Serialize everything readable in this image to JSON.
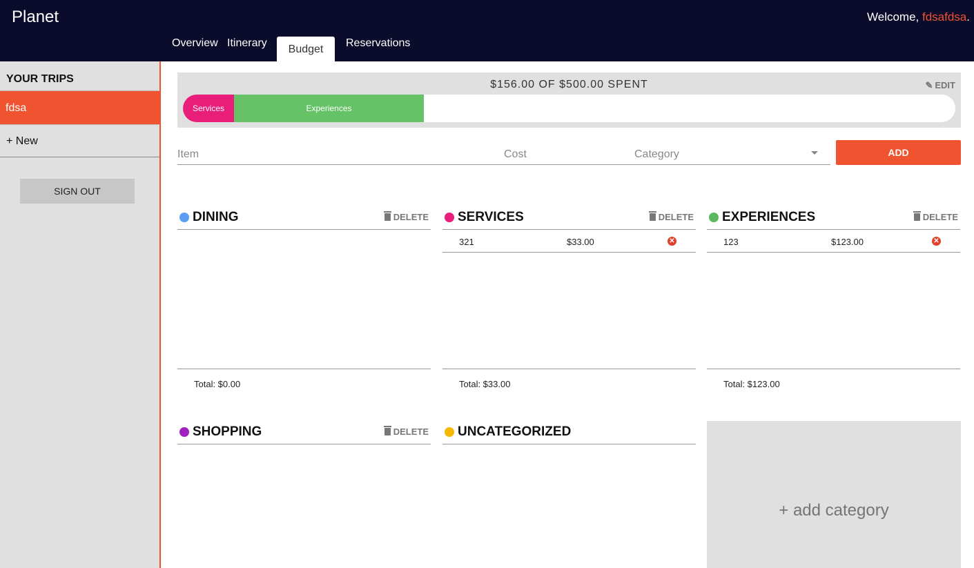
{
  "app": {
    "brand": "Planet"
  },
  "header": {
    "welcome_prefix": "Welcome, ",
    "username": "fdsafdsa",
    "welcome_suffix": "."
  },
  "tabs": [
    {
      "label": "Overview"
    },
    {
      "label": "Itinerary"
    },
    {
      "label": "Budget",
      "active": true
    },
    {
      "label": "Reservations"
    }
  ],
  "sidebar": {
    "title": "YOUR TRIPS",
    "trips": [
      {
        "label": "fdsa",
        "selected": true
      }
    ],
    "new_label": "+ New",
    "signout_label": "SIGN OUT"
  },
  "budget": {
    "summary": "$156.00 OF $500.00 SPENT",
    "edit_label": "EDIT",
    "segments": [
      {
        "label": "Services",
        "amount": 33,
        "color": "#e91e7a"
      },
      {
        "label": "Experiences",
        "amount": 123,
        "color": "#66c266"
      }
    ],
    "budget_total": 500
  },
  "form": {
    "item_placeholder": "Item",
    "cost_placeholder": "Cost",
    "category_placeholder": "Category",
    "add_label": "ADD"
  },
  "categories": {
    "dining": {
      "name": "DINING",
      "color": "#5b9ef4",
      "delete_label": "DELETE",
      "total": "Total: $0.00"
    },
    "services": {
      "name": "SERVICES",
      "color": "#e91e7a",
      "delete_label": "DELETE",
      "total": "Total: $33.00",
      "items": [
        {
          "name": "321",
          "cost": "$33.00"
        }
      ]
    },
    "experiences": {
      "name": "EXPERIENCES",
      "color": "#5cb85c",
      "delete_label": "DELETE",
      "total": "Total: $123.00",
      "items": [
        {
          "name": "123",
          "cost": "$123.00"
        }
      ]
    },
    "shopping": {
      "name": "SHOPPING",
      "color": "#a020c0",
      "delete_label": "DELETE"
    },
    "uncategorized": {
      "name": "UNCATEGORIZED",
      "color": "#f5b800"
    }
  },
  "add_category_label": "+ add category"
}
